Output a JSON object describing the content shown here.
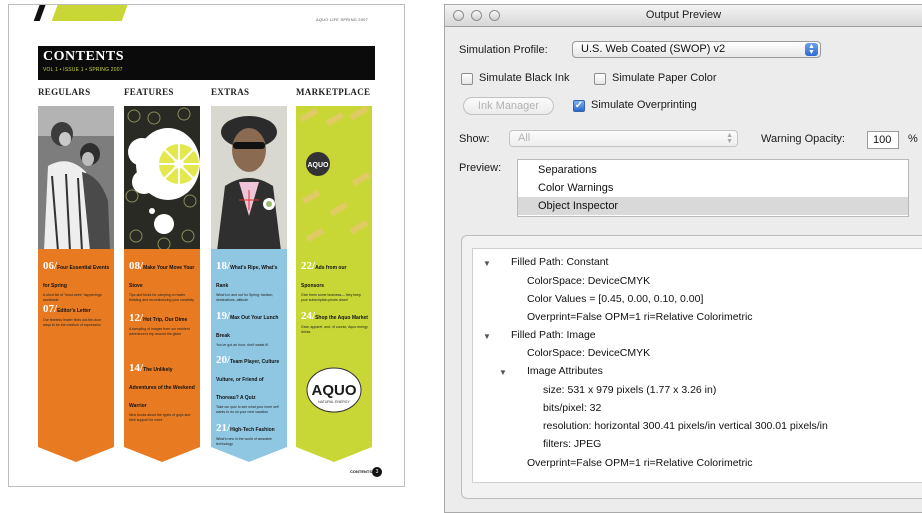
{
  "magazine": {
    "top_tiny_text": "AQUO LIFE SPRING 2007",
    "title": "CONTENTS",
    "subtitle": "VOL 1 • ISSUE 1 • SPRING 2007",
    "columns": [
      {
        "heading": "REGULARS",
        "color": "#e87b22",
        "items": [
          {
            "num": "06/",
            "title": "Four Essential Events for Spring",
            "desc": "A short list of \"must-sees\" happenings worldwide"
          },
          {
            "num": "07/",
            "title": "Editor's Letter",
            "desc": "Our fearless leader finds out-the-door ways to be the medium of expression"
          }
        ]
      },
      {
        "heading": "FEATURES",
        "color": "#e87b22",
        "items": [
          {
            "num": "08/",
            "title": "Make Your Move Your Stove",
            "desc": "Tips and tricks for camping on water thirsting and revolutionizing your creativity"
          },
          {
            "num": "12/",
            "title": "Hot Trip, Our Dime",
            "desc": "A sampling of images from our resident adventurer's trip around the globe"
          },
          {
            "num": "14/",
            "title": "The Unlikely Adventures of the Weekend Warrior",
            "desc": "New books about the types of guys and their support for more"
          }
        ]
      },
      {
        "heading": "EXTRAS",
        "color": "#8fc7e3",
        "items": [
          {
            "num": "18/",
            "title": "What's Ripe, What's Rank",
            "desc": "What's in and out for Spring: fashion, destinations, attitude"
          },
          {
            "num": "19/",
            "title": "Max Out Your Lunch Break",
            "desc": "You've got an hour; don't waste it!"
          },
          {
            "num": "20/",
            "title": "Team Player, Culture Vulture, or Friend of Thoreau? A Quiz",
            "desc": "Take our quiz to see what your inner self wants to do on your next vacation"
          },
          {
            "num": "21/",
            "title": "High-Tech Fashion",
            "desc": "What's new in the world of wearable technology"
          }
        ]
      },
      {
        "heading": "MARKETPLACE",
        "color": "#c8d736",
        "items": [
          {
            "num": "22/",
            "title": "Ads from our Sponsors",
            "desc": "Give them some business— they keep your subscription prices down!"
          },
          {
            "num": "24/",
            "title": "Shop the Aquo Market",
            "desc": "Gear, apparel, and, of course, Aquo energy drinks"
          }
        ],
        "logo_small": "AQUO",
        "logo_big": "AQUO",
        "logo_tag": "NATURAL ENERGY"
      }
    ],
    "footer_label": "CONTENTS",
    "page_number": "3"
  },
  "output_preview": {
    "window_title": "Output Preview",
    "simulation_profile_label": "Simulation Profile:",
    "simulation_profile_value": "U.S. Web Coated (SWOP) v2",
    "simulate_black_ink": {
      "label": "Simulate Black Ink",
      "checked": false
    },
    "simulate_paper_color": {
      "label": "Simulate Paper Color",
      "checked": false
    },
    "ink_manager_label": "Ink Manager",
    "simulate_overprinting": {
      "label": "Simulate Overprinting",
      "checked": true
    },
    "show_label": "Show:",
    "show_value": "All",
    "warning_opacity_label": "Warning Opacity:",
    "warning_opacity_value": "100",
    "warning_opacity_unit": "%",
    "preview_label": "Preview:",
    "preview_items": [
      {
        "label": "Separations",
        "selected": false
      },
      {
        "label": "Color Warnings",
        "selected": false
      },
      {
        "label": "Object Inspector",
        "selected": true
      }
    ],
    "inspector": {
      "node1_title": "Filled Path: Constant",
      "node1_colorspace": "ColorSpace: DeviceCMYK",
      "node1_values": "Color Values = [0.45, 0.00, 0.10, 0.00]",
      "node1_overprint": "Overprint=False OPM=1 ri=Relative Colorimetric",
      "node2_title": "Filled Path: Image",
      "node2_colorspace": "ColorSpace: DeviceCMYK",
      "attr_title": "Image Attributes",
      "attr_size": "size: 531 x 979 pixels (1.77 x 3.26 in)",
      "attr_bits": "bits/pixel: 32",
      "attr_resolution": "resolution: horizontal 300.41 pixels/in vertical 300.01 pixels/in",
      "attr_filters": "filters: JPEG",
      "node2_overprint": "Overprint=False OPM=1 ri=Relative Colorimetric"
    }
  }
}
